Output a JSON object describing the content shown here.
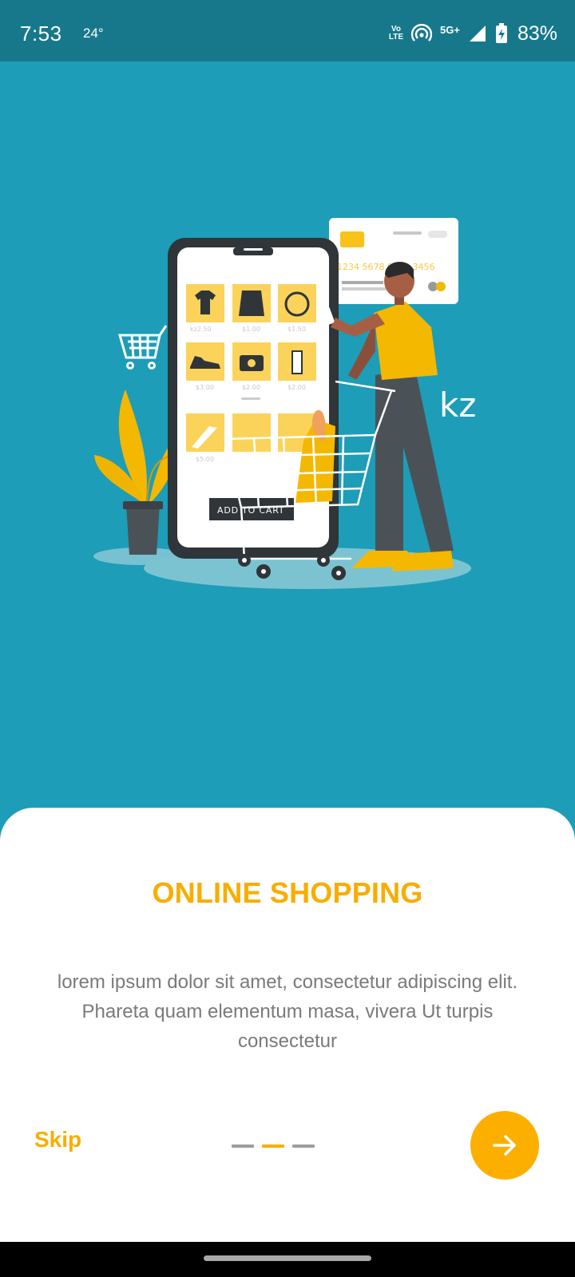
{
  "status_bar": {
    "time": "7:53",
    "temperature": "24°",
    "volte_line1": "Vo",
    "volte_line2": "LTE",
    "network": "5G+",
    "battery": "83%"
  },
  "illustration": {
    "currency": "kz",
    "card_number": "1234  5678  9012  3456",
    "add_to_cart": "ADD TO CART",
    "prices": [
      "kz2.50",
      "$1.00",
      "$1.50",
      "$3.00",
      "$2.00",
      "$2.00",
      "$5.00"
    ]
  },
  "onboarding": {
    "title": "ONLINE SHOPPING",
    "description": "lorem ipsum dolor sit amet, consectetur adipiscing elit. Phareta quam elementum masa, vivera Ut turpis consectetur",
    "skip_label": "Skip",
    "page_count": 3,
    "active_page": 2
  },
  "colors": {
    "accent": "#f9ad00",
    "hero_background": "#1d9db7",
    "status_bar": "#17788c"
  }
}
